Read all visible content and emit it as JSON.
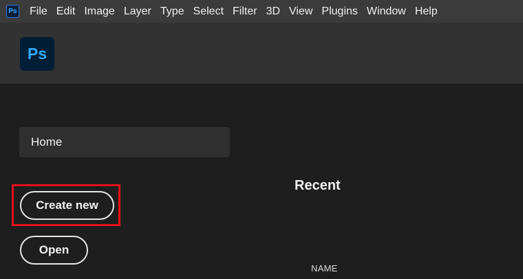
{
  "app": {
    "icon_text": "Ps",
    "logo_text": "Ps"
  },
  "menu": [
    "File",
    "Edit",
    "Image",
    "Layer",
    "Type",
    "Select",
    "Filter",
    "3D",
    "View",
    "Plugins",
    "Window",
    "Help"
  ],
  "sidebar": {
    "home_label": "Home"
  },
  "buttons": {
    "create_new": "Create new",
    "open": "Open"
  },
  "recent": {
    "title": "Recent",
    "column_name": "NAME"
  },
  "colors": {
    "highlight": "#e3101a",
    "ps_blue": "#31a8ff",
    "ps_navy": "#001e36"
  }
}
